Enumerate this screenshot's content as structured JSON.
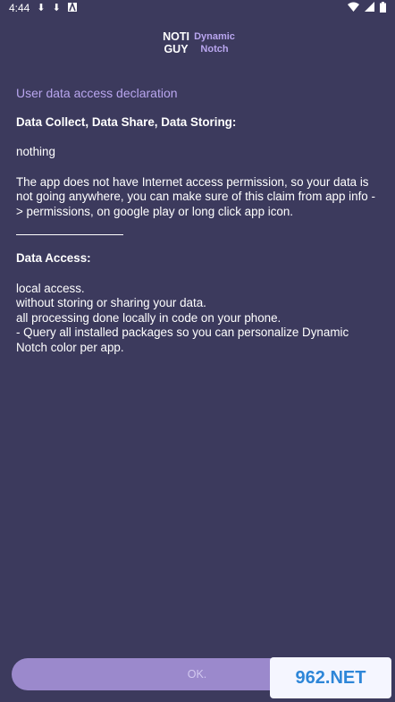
{
  "status": {
    "time": "4:44",
    "left_icons": [
      "download-icon",
      "download-icon",
      "a-badge-icon"
    ],
    "right_icons": [
      "wifi-icon",
      "signal-icon",
      "battery-icon"
    ]
  },
  "logo": {
    "left_line1": "NOTI",
    "left_line2": "GUY",
    "right_line1": "Dynamic",
    "right_line2": "Notch"
  },
  "content": {
    "title": "User data access declaration",
    "heading1": "Data Collect, Data Share, Data Storing:",
    "nothing": "nothing",
    "paragraph": "The app does not have Internet access permission, so your data is not going anywhere, you can make sure of this claim from app info -> permissions, on google play or long click app icon.",
    "heading2": "Data Access:",
    "access_lines": [
      "local access.",
      "without storing or sharing your data.",
      "all processing done locally in code on your phone.",
      "- Query all installed packages so you can personalize Dynamic Notch color per app."
    ]
  },
  "ok_label": "OK.",
  "watermark_text": "962.NET",
  "colors": {
    "background": "#3c3a5d",
    "accent": "#b9a6ef",
    "button": "#9b89cc"
  }
}
